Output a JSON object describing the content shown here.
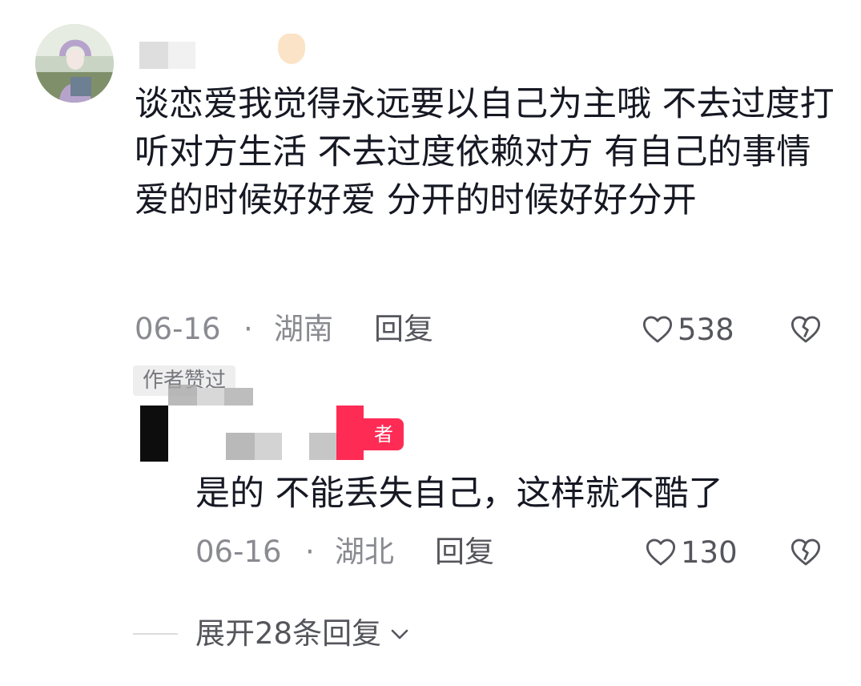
{
  "comment": {
    "text": "谈恋爱我觉得永远要以自己为主哦 不去过度打听对方生活 不去过度依赖对方 有自己的事情 爱的时候好好爱 分开的时候好好分开",
    "date": "06-16",
    "separator": "·",
    "location": "湖南",
    "reply_label": "回复",
    "like_count": "538",
    "author_liked_badge": "作者赞过"
  },
  "reply": {
    "badge_glyph": "者",
    "text": "是的 不能丢失自己，这样就不酷了",
    "date": "06-16",
    "separator": "·",
    "location": "湖北",
    "reply_label": "回复",
    "like_count": "130"
  },
  "expand_replies": {
    "label": "展开28条回复"
  },
  "icons": {
    "like": "heart-outline-icon",
    "dislike": "broken-heart-icon",
    "expand": "chevron-down-icon"
  },
  "colors": {
    "text": "#161823",
    "meta": "#8a8b91",
    "action": "#55565c",
    "author_badge": "#fe2c55"
  }
}
